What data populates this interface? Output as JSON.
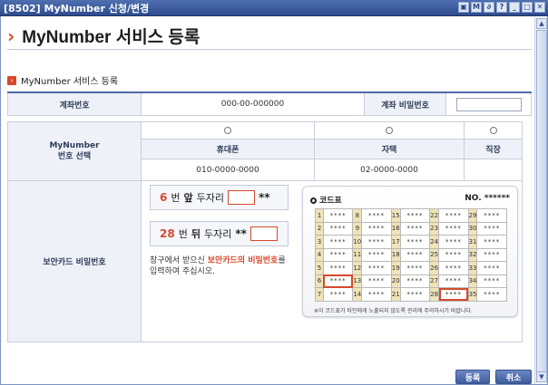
{
  "window": {
    "title": "[8502] MyNumber 신청/변경"
  },
  "header": {
    "title": "MyNumber 서비스 등록"
  },
  "section": {
    "title": "MyNumber 서비스 등록"
  },
  "account": {
    "label": "계좌번호",
    "value": "000-00-000000",
    "pwd_label": "계좌 비밀번호",
    "pwd_value": ""
  },
  "mynumber": {
    "label_line1": "MyNumber",
    "label_line2": "번호 선택",
    "options": [
      {
        "label": "휴대폰",
        "value": "010-0000-0000"
      },
      {
        "label": "자택",
        "value": "02-0000-0000"
      },
      {
        "label": "직장",
        "value": ""
      }
    ]
  },
  "security": {
    "label": "보안카드 비밀번호",
    "row1": {
      "num": "6",
      "mid": "번",
      "pos": "앞",
      "tail": "두자리",
      "stars": "**"
    },
    "row2": {
      "num": "28",
      "mid": "번",
      "pos": "뒤",
      "tail": "두자리",
      "stars": "**"
    },
    "note_pre": "창구에서 받으신 ",
    "note_em": "보안카드의 비밀번호",
    "note_post": "를",
    "note_line2": "입력하여 주십시오."
  },
  "card": {
    "title": "코드표",
    "no_label": "NO.",
    "no_value": "******",
    "mask": "****",
    "footer": "※이 코드표가 타인에게 노출되지 않도록 관리에 주의하시기 바랍니다.",
    "rows": [
      [
        "1",
        "8",
        "15",
        "22",
        "29"
      ],
      [
        "2",
        "9",
        "16",
        "23",
        "30"
      ],
      [
        "3",
        "10",
        "17",
        "24",
        "31"
      ],
      [
        "4",
        "11",
        "18",
        "25",
        "32"
      ],
      [
        "5",
        "12",
        "19",
        "26",
        "33"
      ],
      [
        "6",
        "13",
        "20",
        "27",
        "34"
      ],
      [
        "7",
        "14",
        "21",
        "28",
        "35"
      ]
    ]
  },
  "buttons": {
    "register": "등록",
    "cancel": "취소"
  }
}
